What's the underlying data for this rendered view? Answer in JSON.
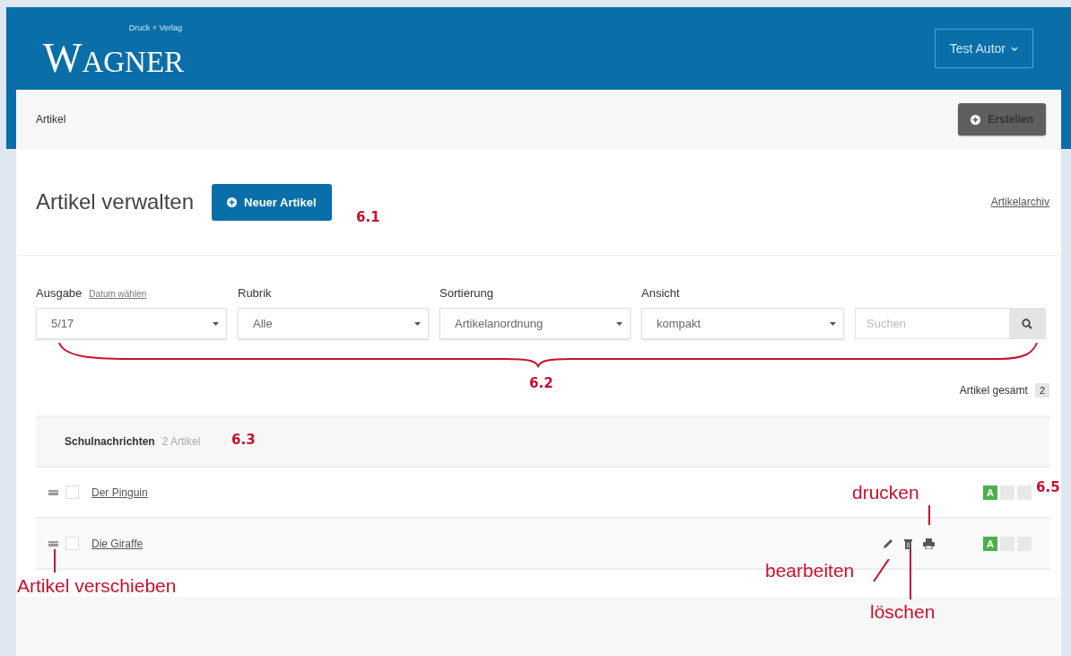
{
  "header": {
    "logo": "WAGNER",
    "tagline": "Druck + Verlag",
    "user_menu": "Test Autor"
  },
  "breadcrumb": {
    "label": "Artikel",
    "create_button": "Erstellen"
  },
  "page": {
    "title": "Artikel verwalten",
    "new_button": "Neuer Artikel",
    "archive_link": "Artikelarchiv"
  },
  "filters": [
    {
      "kind": "select",
      "label": "Ausgabe",
      "link": "Datum wählen",
      "value": "5/17"
    },
    {
      "kind": "select",
      "label": "Rubrik",
      "value": "Alle"
    },
    {
      "kind": "select",
      "label": "Sortierung",
      "value": "Artikelanordnung"
    },
    {
      "kind": "select",
      "label": "Ansicht",
      "value": "kompakt"
    },
    {
      "kind": "search",
      "placeholder": "Suchen"
    }
  ],
  "total": {
    "label": "Artikel gesamt",
    "count": "2"
  },
  "group": {
    "name": "Schulnachrichten",
    "count": "2 Artikel"
  },
  "rows": [
    {
      "title": "Der Pinguin",
      "checked": false,
      "actions_visible": false,
      "badges": [
        {
          "label": "A",
          "on": true
        },
        {
          "on": false
        },
        {
          "on": false
        }
      ]
    },
    {
      "title": "Die Giraffe",
      "checked": false,
      "actions_visible": true,
      "badges": [
        {
          "label": "A",
          "on": true
        },
        {
          "on": false
        },
        {
          "on": false
        }
      ]
    }
  ],
  "annotations": [
    {
      "kind": "number",
      "text": "6.1"
    },
    {
      "kind": "number",
      "text": "6.2"
    },
    {
      "kind": "number",
      "text": "6.3"
    },
    {
      "kind": "number",
      "text": "6.5"
    },
    {
      "kind": "callout",
      "text": "drucken"
    },
    {
      "kind": "callout",
      "text": "bearbeiten"
    },
    {
      "kind": "callout",
      "text": "löschen"
    },
    {
      "kind": "callout",
      "text": "Artikel verschieben"
    }
  ]
}
